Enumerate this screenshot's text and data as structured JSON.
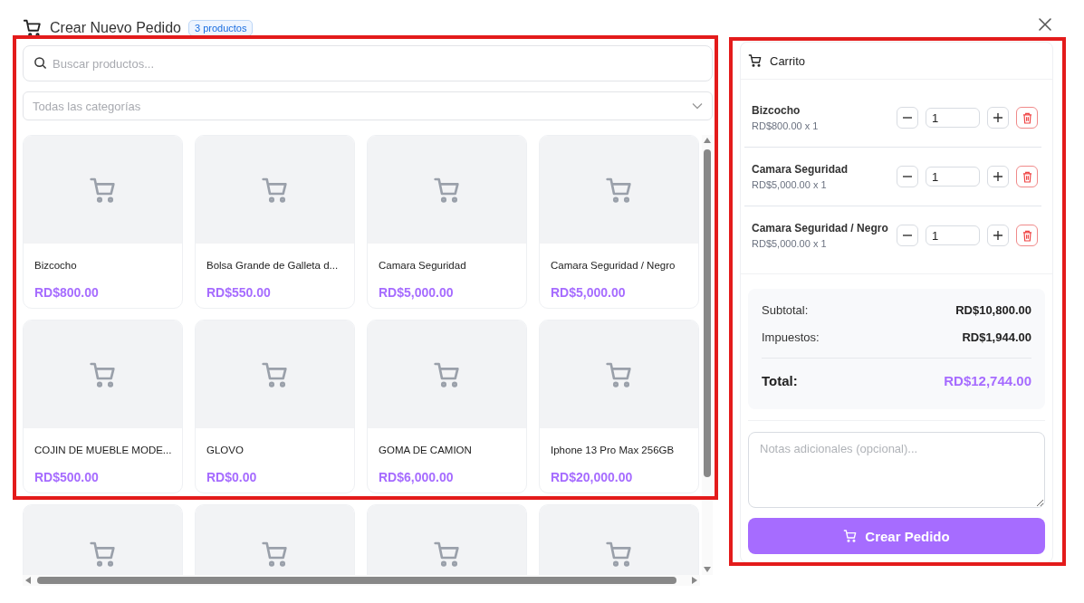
{
  "dialog": {
    "title": "Crear Nuevo Pedido",
    "badge": "3 productos"
  },
  "search": {
    "placeholder": "Buscar productos..."
  },
  "category": {
    "placeholder": "Todas las categorías"
  },
  "products": [
    {
      "kind": "card",
      "name": "Bizcocho",
      "price": "RD$800.00"
    },
    {
      "kind": "card",
      "name": "Bolsa Grande de Galleta d...",
      "price": "RD$550.00"
    },
    {
      "kind": "card",
      "name": "Camara Seguridad",
      "price": "RD$5,000.00"
    },
    {
      "kind": "card",
      "name": "Camara Seguridad / Negro",
      "price": "RD$5,000.00"
    },
    {
      "kind": "card",
      "name": "COJIN DE MUEBLE MODE...",
      "price": "RD$500.00"
    },
    {
      "kind": "card",
      "name": "GLOVO",
      "price": "RD$0.00"
    },
    {
      "kind": "card",
      "name": "GOMA DE CAMION",
      "price": "RD$6,000.00"
    },
    {
      "kind": "card",
      "name": "Iphone 13 Pro Max 256GB",
      "price": "RD$20,000.00"
    },
    {
      "kind": "image_only"
    },
    {
      "kind": "image_only"
    },
    {
      "kind": "image_only"
    },
    {
      "kind": "image_only"
    }
  ],
  "cart": {
    "title": "Carrito",
    "items": [
      {
        "name": "Bizcocho",
        "detail": "RD$800.00 x 1",
        "quantity": "1"
      },
      {
        "name": "Camara Seguridad",
        "detail": "RD$5,000.00 x 1",
        "quantity": "1"
      },
      {
        "name": "Camara Seguridad / Negro",
        "detail": "RD$5,000.00 x 1",
        "quantity": "1"
      }
    ],
    "subtotal_label": "Subtotal:",
    "subtotal": "RD$10,800.00",
    "tax_label": "Impuestos:",
    "tax": "RD$1,944.00",
    "total_label": "Total:",
    "total": "RD$12,744.00",
    "notes": {
      "placeholder": "Notas adicionales (opcional)..."
    },
    "submit": "Crear Pedido"
  }
}
